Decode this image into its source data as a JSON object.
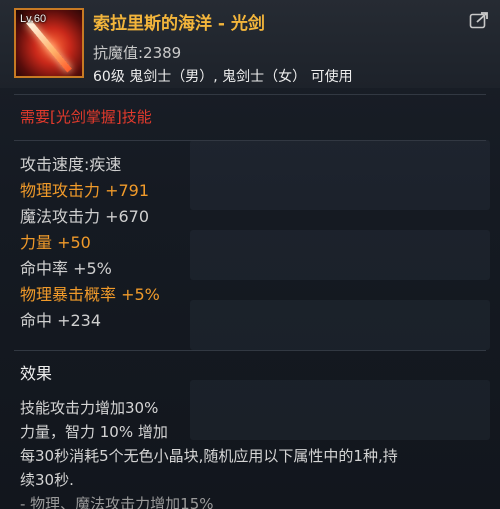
{
  "item": {
    "level": "Lv.60",
    "name": "索拉里斯的海洋 - 光剑",
    "resist": "抗魔值:2389",
    "restriction": "60级 鬼剑士（男）, 鬼剑士（女） 可使用",
    "requirement": "需要[光剑掌握]技能",
    "icon": "lightsaber-icon",
    "share_icon": "share-icon"
  },
  "stats": [
    {
      "text": "攻击速度:疾速",
      "highlight": false
    },
    {
      "text": "物理攻击力 +791",
      "highlight": true
    },
    {
      "text": "魔法攻击力 +670",
      "highlight": false
    },
    {
      "text": "力量 +50",
      "highlight": true
    },
    {
      "text": "命中率 +5%",
      "highlight": false
    },
    {
      "text": "物理暴击概率 +5%",
      "highlight": true
    },
    {
      "text": "命中 +234",
      "highlight": false
    }
  ],
  "effects": {
    "title": "效果",
    "lines": [
      "技能攻击力增加30%",
      "力量，智力 10% 增加",
      "每30秒消耗5个无色小晶块,随机应用以下属性中的1种,持",
      "续30秒.",
      "- 物理、魔法攻击力增加15%"
    ]
  },
  "colors": {
    "title": "#f3b53b",
    "requirement": "#e23a2c",
    "highlight": "#f09a2a",
    "border": "#c77a23"
  }
}
